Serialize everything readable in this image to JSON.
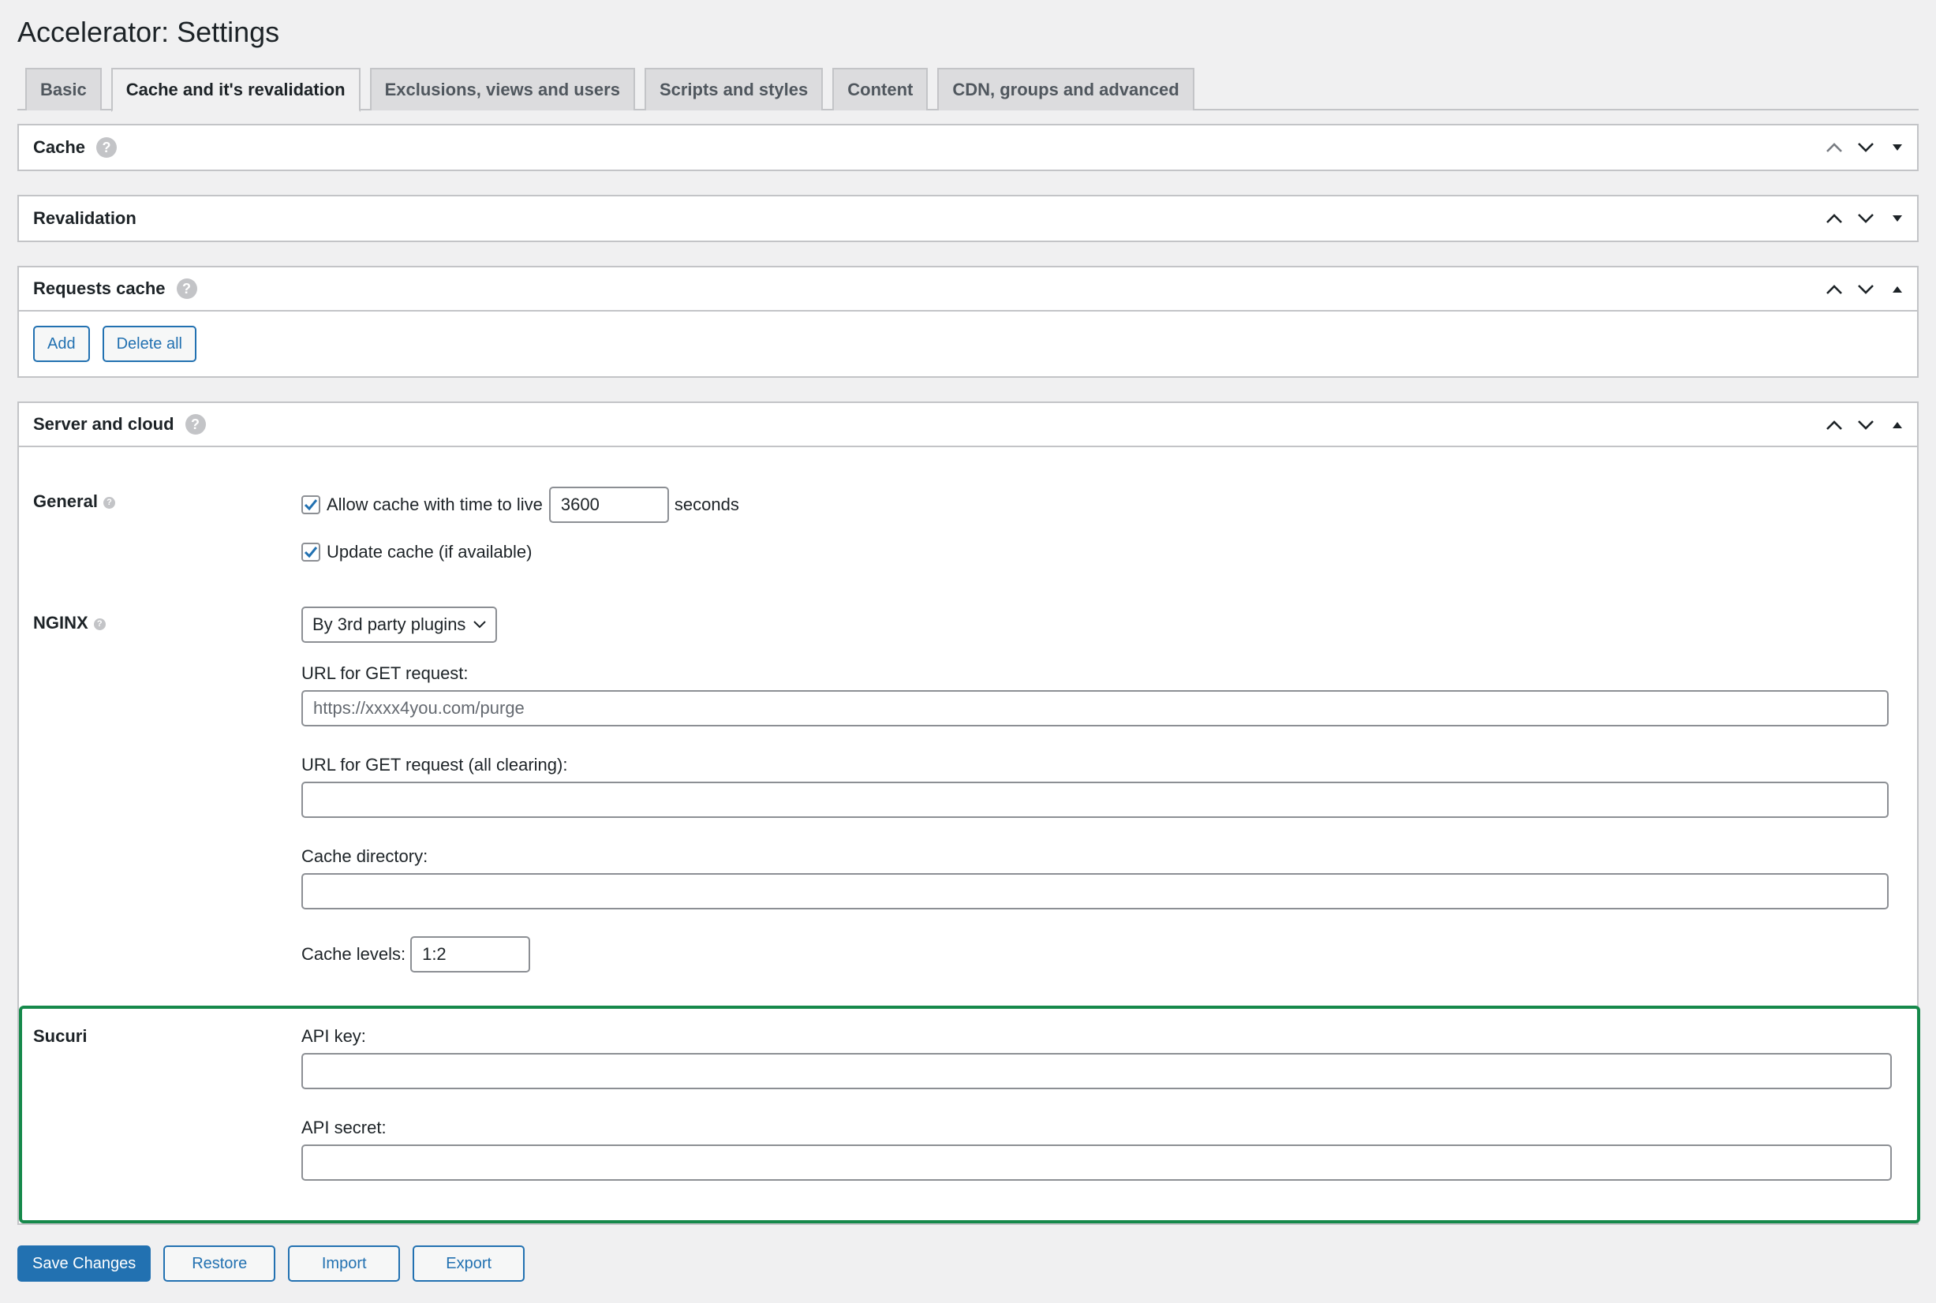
{
  "page_title": "Accelerator: Settings",
  "tabs": [
    {
      "label": "Basic"
    },
    {
      "label": "Cache and it's revalidation"
    },
    {
      "label": "Exclusions, views and users"
    },
    {
      "label": "Scripts and styles"
    },
    {
      "label": "Content"
    },
    {
      "label": "CDN, groups and advanced"
    }
  ],
  "boxes": {
    "cache": {
      "title": "Cache",
      "help": "?"
    },
    "revalidation": {
      "title": "Revalidation"
    },
    "requests_cache": {
      "title": "Requests cache",
      "help": "?",
      "add_label": "Add",
      "delete_all_label": "Delete all"
    },
    "server_cloud": {
      "title": "Server and cloud",
      "help": "?"
    }
  },
  "general": {
    "label": "General",
    "help": "?",
    "allow_cache_label": "Allow cache with time to live",
    "allow_cache_checked": true,
    "ttl_value": "3600",
    "ttl_unit": "seconds",
    "update_cache_label": "Update cache (if available)",
    "update_cache_checked": true
  },
  "nginx": {
    "label": "NGINX",
    "help": "?",
    "mode_selected": "By 3rd party plugins",
    "url_get_label": "URL for GET request:",
    "url_get_placeholder": "https://xxxx4you.com/purge",
    "url_get_all_label": "URL for GET request (all clearing):",
    "url_get_all_value": "",
    "cache_dir_label": "Cache directory:",
    "cache_dir_value": "",
    "cache_levels_label": "Cache levels:",
    "cache_levels_value": "1:2"
  },
  "sucuri": {
    "label": "Sucuri",
    "api_key_label": "API key:",
    "api_key_value": "",
    "api_secret_label": "API secret:",
    "api_secret_value": ""
  },
  "actions": {
    "save_label": "Save Changes",
    "restore_label": "Restore",
    "import_label": "Import",
    "export_label": "Export"
  },
  "colors": {
    "accent": "#2271b1",
    "highlight_border": "#16894b",
    "background": "#f0f0f1"
  }
}
